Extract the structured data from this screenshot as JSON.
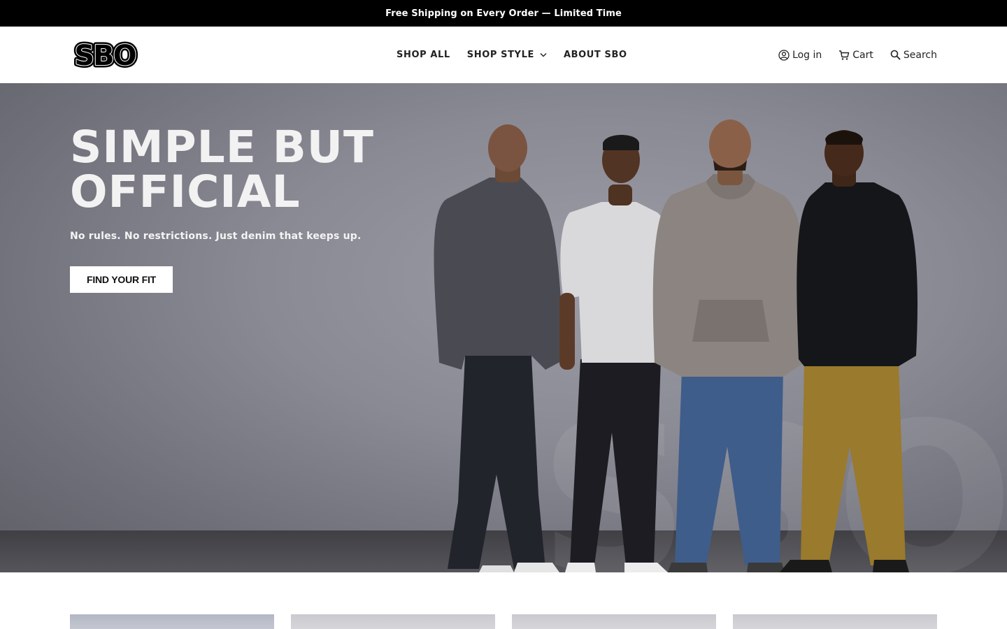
{
  "announcement": {
    "text": "Free Shipping on Every Order — Limited Time"
  },
  "header": {
    "logo_text": "SBO",
    "nav": [
      {
        "label": "SHOP ALL"
      },
      {
        "label": "SHOP STYLE",
        "has_dropdown": true
      },
      {
        "label": "ABOUT SBO"
      }
    ],
    "utility": {
      "login_label": "Log in",
      "cart_label": "Cart",
      "search_label": "Search"
    }
  },
  "hero": {
    "title_line1": "SIMPLE BUT",
    "title_line2": "OFFICIAL",
    "subtitle": "No rules. No restrictions. Just denim that keeps up.",
    "cta_label": "FIND YOUR FIT",
    "watermark_text": "SBO"
  },
  "collections": {
    "cards": [
      {
        "name": "collection-card-1"
      },
      {
        "name": "collection-card-2"
      },
      {
        "name": "collection-card-3"
      },
      {
        "name": "collection-card-4"
      }
    ]
  },
  "colors": {
    "announcement_bg": "#000000",
    "header_bg": "#ffffff",
    "hero_bg": "#8a8a94",
    "button_bg": "#ffffff",
    "text_dark": "#222222"
  },
  "icons": {
    "login": "user-circle-icon",
    "cart": "cart-icon",
    "search": "search-icon",
    "dropdown": "chevron-down-icon"
  }
}
